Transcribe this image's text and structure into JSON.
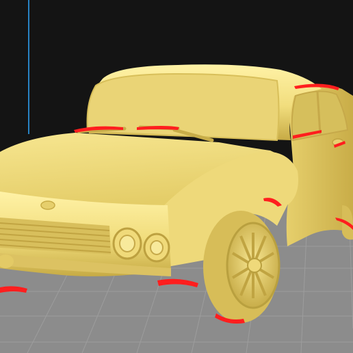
{
  "viewport": {
    "background_color": "#141414",
    "build_plate_color": "#8c8c8c",
    "grid_line_color": "#9d9d9d",
    "axis_color": "#2ea8ff"
  },
  "model": {
    "name": "car-model",
    "body_color": "#f1dd7d",
    "highlight_color": "#fff2a6",
    "shadow_color": "#c7ab45",
    "overhang_color": "#ff1e1e",
    "glass_color": "#d6bf5c"
  }
}
